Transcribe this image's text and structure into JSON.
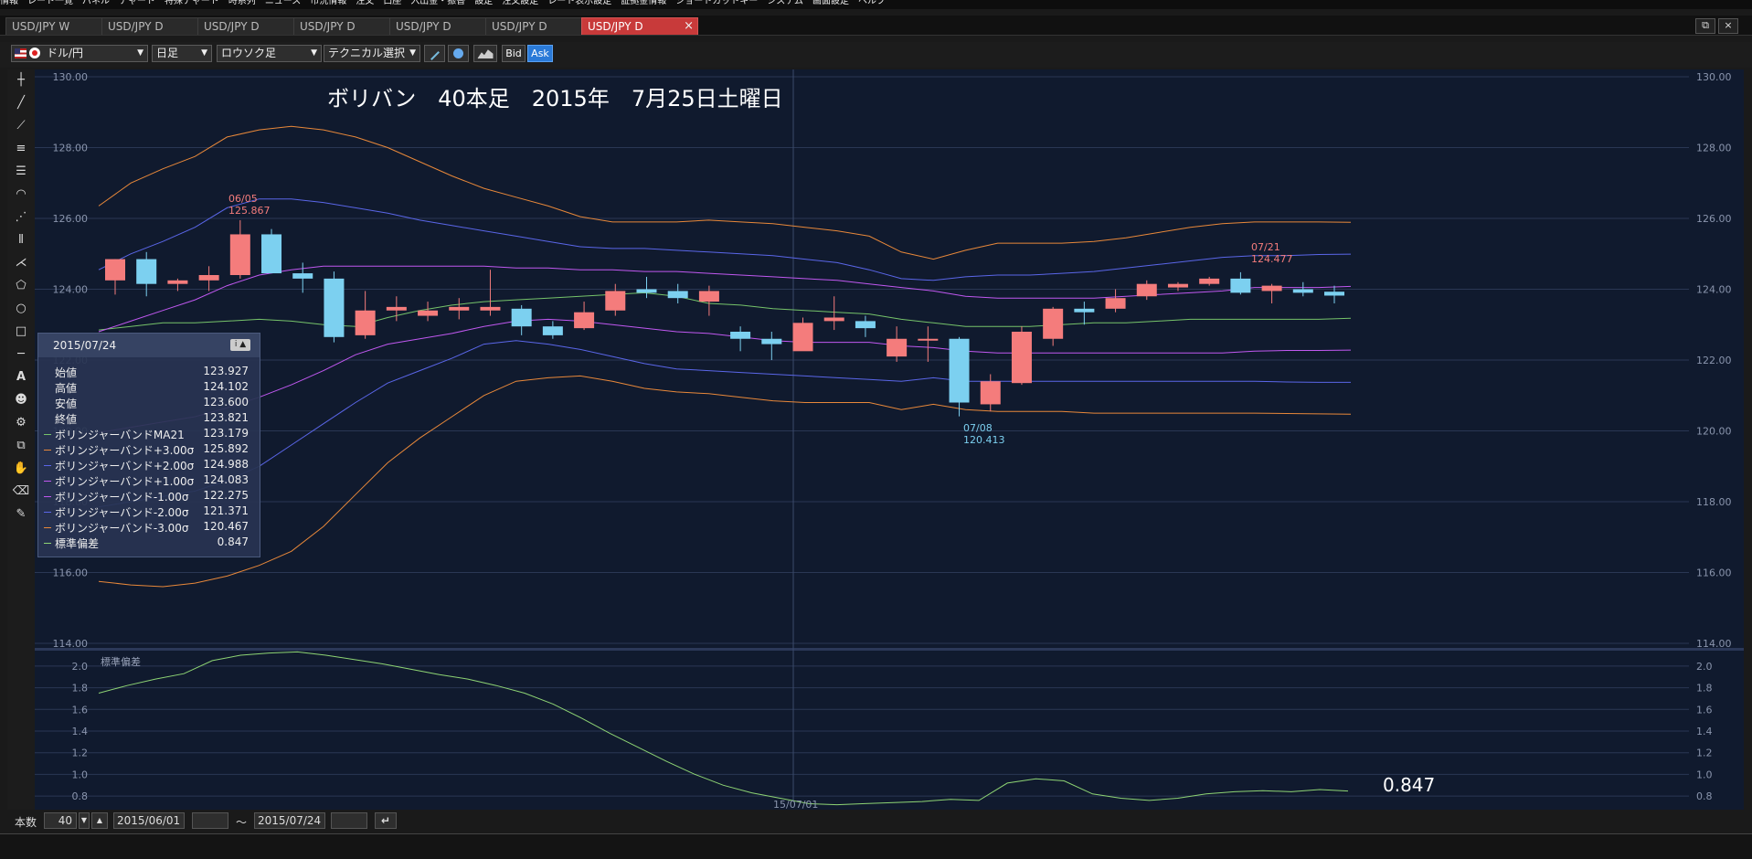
{
  "top_menu": [
    "情報",
    "レート一覧",
    "パネル",
    "チャート",
    "特殊チャート",
    "時系列",
    "ニュース",
    "市況情報",
    "注文",
    "口座",
    "入出金・振替",
    "設定",
    "注文設定",
    "レート表示設定",
    "証拠金情報",
    "ショートカットキー",
    "システム",
    "画面設定",
    "ヘルプ"
  ],
  "tabs": [
    {
      "label": "USD/JPY W",
      "active": false
    },
    {
      "label": "USD/JPY D",
      "active": false
    },
    {
      "label": "USD/JPY D",
      "active": false
    },
    {
      "label": "USD/JPY D",
      "active": false
    },
    {
      "label": "USD/JPY D",
      "active": false
    },
    {
      "label": "USD/JPY D",
      "active": false
    },
    {
      "label": "USD/JPY D",
      "active": true
    }
  ],
  "close_glyph": "×",
  "window_buttons": [
    "⧉",
    "×"
  ],
  "toolbar": {
    "symbol": "ドル/円",
    "timeframe": "日足",
    "chart_type": "ロウソク足",
    "technical": "テクニカル選択",
    "bid_label": "Bid",
    "ask_label": "Ask",
    "caret": "▼"
  },
  "chart": {
    "title": "ボリバン　40本足　2015年　7月25日土曜日",
    "annotations": [
      {
        "date": "06/05",
        "value": "125.867"
      },
      {
        "date": "07/21",
        "value": "124.477"
      },
      {
        "date": "07/08",
        "value": "120.413"
      }
    ],
    "x_tick": "15/07/01",
    "sub_label": "標準偏差",
    "sub_value": "0.847"
  },
  "colors": {
    "up": "#f47c7c",
    "down": "#7cd0f0",
    "ma": "#76c36a",
    "s1": "#c058f0",
    "s2": "#5a66e8",
    "s3": "#e8883a",
    "sd": "#8ed474",
    "grid": "#2a3754",
    "bg": "#101a2e"
  },
  "info_panel": {
    "date": "2015/07/24",
    "rows": [
      {
        "label": "始値",
        "value": "123.927",
        "color": ""
      },
      {
        "label": "高値",
        "value": "124.102",
        "color": ""
      },
      {
        "label": "安値",
        "value": "123.600",
        "color": ""
      },
      {
        "label": "終値",
        "value": "123.821",
        "color": ""
      },
      {
        "label": "ボリンジャーバンドMA21",
        "value": "123.179",
        "color": "#76c36a"
      },
      {
        "label": "ボリンジャーバンド+3.00σ",
        "value": "125.892",
        "color": "#e8883a"
      },
      {
        "label": "ボリンジャーバンド+2.00σ",
        "value": "124.988",
        "color": "#5a66e8"
      },
      {
        "label": "ボリンジャーバンド+1.00σ",
        "value": "124.083",
        "color": "#c058f0"
      },
      {
        "label": "ボリンジャーバンド-1.00σ",
        "value": "122.275",
        "color": "#c058f0"
      },
      {
        "label": "ボリンジャーバンド-2.00σ",
        "value": "121.371",
        "color": "#5a66e8"
      },
      {
        "label": "ボリンジャーバンド-3.00σ",
        "value": "120.467",
        "color": "#e8883a"
      },
      {
        "label": "標準偏差",
        "value": "0.847",
        "color": "#8ed474"
      }
    ]
  },
  "bottom": {
    "count_label": "本数",
    "count_value": "40",
    "from_date": "2015/06/01",
    "tilde": "〜",
    "to_date": "2015/07/24"
  },
  "chart_data": [
    {
      "type": "line",
      "subtype": "candlestick",
      "ylim": [
        114,
        130
      ],
      "yticks": [
        "130.00",
        "128.00",
        "126.00",
        "124.00",
        "122.00",
        "120.00",
        "118.00",
        "116.00",
        "114.00"
      ],
      "candles": [
        [
          124.25,
          124.85,
          123.85,
          124.85
        ],
        [
          124.85,
          125.05,
          123.8,
          124.15
        ],
        [
          124.15,
          124.3,
          123.95,
          124.25
        ],
        [
          124.25,
          124.65,
          123.95,
          124.4
        ],
        [
          124.4,
          125.95,
          124.3,
          125.55
        ],
        [
          125.55,
          125.7,
          124.45,
          124.45
        ],
        [
          124.45,
          124.75,
          123.9,
          124.3
        ],
        [
          124.3,
          124.5,
          122.5,
          122.65
        ],
        [
          122.7,
          123.95,
          122.6,
          123.4
        ],
        [
          123.4,
          123.8,
          123.1,
          123.5
        ],
        [
          123.25,
          123.65,
          123.1,
          123.4
        ],
        [
          123.4,
          123.75,
          123.15,
          123.5
        ],
        [
          123.4,
          124.55,
          123.25,
          123.5
        ],
        [
          123.45,
          123.55,
          122.7,
          122.95
        ],
        [
          122.95,
          123.1,
          122.6,
          122.7
        ],
        [
          122.9,
          123.65,
          122.85,
          123.35
        ],
        [
          123.4,
          124.15,
          123.25,
          123.95
        ],
        [
          124.0,
          124.35,
          123.75,
          123.9
        ],
        [
          123.95,
          124.15,
          123.6,
          123.75
        ],
        [
          123.65,
          124.1,
          123.25,
          123.95
        ],
        [
          122.8,
          122.95,
          122.25,
          122.6
        ],
        [
          122.6,
          122.8,
          122.0,
          122.45
        ],
        [
          122.25,
          123.2,
          122.45,
          123.05
        ],
        [
          123.1,
          123.8,
          122.85,
          123.2
        ],
        [
          123.1,
          123.25,
          122.65,
          122.9
        ],
        [
          122.1,
          122.95,
          121.95,
          122.6
        ],
        [
          122.6,
          122.95,
          121.95,
          122.6
        ],
        [
          122.6,
          122.65,
          120.41,
          120.8
        ],
        [
          120.75,
          121.6,
          120.55,
          121.4
        ],
        [
          121.35,
          122.95,
          121.3,
          122.8
        ],
        [
          122.6,
          123.5,
          122.4,
          123.45
        ],
        [
          123.45,
          123.65,
          123.0,
          123.35
        ],
        [
          123.45,
          124.0,
          123.35,
          123.75
        ],
        [
          123.8,
          124.25,
          123.7,
          124.15
        ],
        [
          124.05,
          124.2,
          123.95,
          124.15
        ],
        [
          124.15,
          124.35,
          124.1,
          124.3
        ],
        [
          124.3,
          124.48,
          123.85,
          123.9
        ],
        [
          123.95,
          124.15,
          123.6,
          124.1
        ],
        [
          124.0,
          124.2,
          123.8,
          123.9
        ],
        [
          123.93,
          124.1,
          123.6,
          123.82
        ]
      ],
      "bands": {
        "ma": [
          122.85,
          122.95,
          123.05,
          123.05,
          123.1,
          123.15,
          123.1,
          123.0,
          122.95,
          123.2,
          123.4,
          123.55,
          123.65,
          123.7,
          123.75,
          123.8,
          123.85,
          123.9,
          123.8,
          123.6,
          123.55,
          123.45,
          123.4,
          123.35,
          123.3,
          123.15,
          123.05,
          122.95,
          122.95,
          122.95,
          123.0,
          123.05,
          123.05,
          123.1,
          123.15,
          123.15,
          123.15,
          123.15,
          123.15,
          123.18
        ],
        "p1": [
          122.8,
          123.1,
          123.4,
          123.7,
          124.1,
          124.4,
          124.55,
          124.65,
          124.65,
          124.65,
          124.65,
          124.65,
          124.65,
          124.6,
          124.6,
          124.55,
          124.55,
          124.5,
          124.5,
          124.45,
          124.4,
          124.35,
          124.3,
          124.25,
          124.15,
          124.05,
          123.95,
          123.8,
          123.75,
          123.75,
          123.75,
          123.75,
          123.8,
          123.85,
          123.9,
          123.95,
          124.05,
          124.05,
          124.05,
          124.08
        ],
        "p2": [
          124.55,
          125.0,
          125.35,
          125.75,
          126.3,
          126.55,
          126.55,
          126.45,
          126.3,
          126.15,
          125.95,
          125.8,
          125.65,
          125.5,
          125.35,
          125.2,
          125.15,
          125.15,
          125.1,
          125.05,
          125.0,
          124.95,
          124.85,
          124.75,
          124.55,
          124.3,
          124.25,
          124.35,
          124.4,
          124.4,
          124.45,
          124.5,
          124.6,
          124.7,
          124.8,
          124.9,
          124.95,
          124.95,
          124.98,
          124.99
        ],
        "p3": [
          126.35,
          127.0,
          127.4,
          127.75,
          128.3,
          128.5,
          128.6,
          128.5,
          128.3,
          128.0,
          127.6,
          127.2,
          126.85,
          126.6,
          126.35,
          126.05,
          125.9,
          125.9,
          125.9,
          125.95,
          125.9,
          125.85,
          125.75,
          125.65,
          125.5,
          125.05,
          124.85,
          125.1,
          125.3,
          125.3,
          125.3,
          125.35,
          125.45,
          125.6,
          125.75,
          125.85,
          125.9,
          125.9,
          125.9,
          125.89
        ],
        "m1": [
          119.95,
          120.1,
          120.25,
          120.4,
          120.65,
          120.95,
          121.3,
          121.7,
          122.15,
          122.45,
          122.6,
          122.75,
          122.95,
          123.1,
          123.15,
          123.1,
          123.0,
          122.9,
          122.8,
          122.75,
          122.65,
          122.55,
          122.5,
          122.5,
          122.5,
          122.4,
          122.35,
          122.25,
          122.2,
          122.2,
          122.2,
          122.2,
          122.2,
          122.2,
          122.2,
          122.2,
          122.25,
          122.27,
          122.27,
          122.28
        ],
        "m2": [
          117.85,
          118.0,
          118.15,
          118.3,
          118.6,
          119.0,
          119.6,
          120.2,
          120.8,
          121.35,
          121.7,
          122.05,
          122.45,
          122.55,
          122.45,
          122.3,
          122.1,
          121.9,
          121.75,
          121.7,
          121.65,
          121.6,
          121.55,
          121.5,
          121.45,
          121.4,
          121.5,
          121.4,
          121.4,
          121.4,
          121.4,
          121.4,
          121.4,
          121.4,
          121.4,
          121.4,
          121.4,
          121.38,
          121.37,
          121.37
        ],
        "m3": [
          115.75,
          115.65,
          115.6,
          115.7,
          115.9,
          116.2,
          116.6,
          117.3,
          118.2,
          119.1,
          119.8,
          120.4,
          121.0,
          121.4,
          121.5,
          121.55,
          121.4,
          121.2,
          121.1,
          121.05,
          120.95,
          120.85,
          120.8,
          120.8,
          120.8,
          120.6,
          120.75,
          120.6,
          120.55,
          120.55,
          120.55,
          120.5,
          120.5,
          120.5,
          120.5,
          120.5,
          120.5,
          120.49,
          120.48,
          120.47
        ]
      },
      "annotations": [
        "06/05 125.867",
        "07/21 124.477",
        "07/08 120.413"
      ]
    },
    {
      "type": "line",
      "title": "標準偏差",
      "ylim": [
        0.7,
        2.1
      ],
      "yticks": [
        "2.0",
        "1.8",
        "1.6",
        "1.4",
        "1.2",
        "1.0",
        "0.8"
      ],
      "values": [
        1.75,
        1.82,
        1.88,
        1.93,
        2.05,
        2.1,
        2.12,
        2.13,
        2.1,
        2.06,
        2.02,
        1.97,
        1.92,
        1.88,
        1.82,
        1.75,
        1.65,
        1.52,
        1.38,
        1.25,
        1.12,
        1.0,
        0.9,
        0.83,
        0.78,
        0.73,
        0.72,
        0.73,
        0.74,
        0.75,
        0.77,
        0.76,
        0.92,
        0.96,
        0.94,
        0.82,
        0.78,
        0.76,
        0.78,
        0.82,
        0.84,
        0.85,
        0.84,
        0.86,
        0.847
      ]
    }
  ]
}
